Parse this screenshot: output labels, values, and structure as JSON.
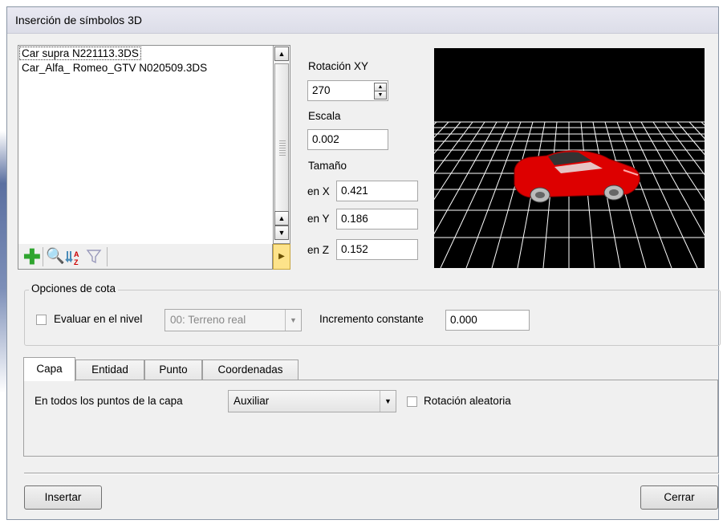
{
  "window": {
    "title": "Inserción de símbolos 3D"
  },
  "symbols": {
    "items": [
      "Car supra N221113.3DS",
      "Car_Alfa_ Romeo_GTV N020509.3DS"
    ],
    "selected_index": 0,
    "toolbar_icons": [
      "add-icon",
      "zoom-icon",
      "sort-az-icon",
      "filter-icon",
      "play-arrow-icon"
    ]
  },
  "rotation": {
    "label": "Rotación XY",
    "value": "270"
  },
  "scale": {
    "label": "Escala",
    "value": "0.002"
  },
  "size": {
    "label": "Tamaño",
    "x_label": "en X",
    "x_value": "0.421",
    "y_label": "en Y",
    "y_value": "0.186",
    "z_label": "en Z",
    "z_value": "0.152"
  },
  "preview": {
    "background": "#000000",
    "grid_color": "#ffffff",
    "model_color": "#dd0000"
  },
  "cota": {
    "legend": "Opciones de cota",
    "evaluate_label": "Evaluar en el nivel",
    "evaluate_checked": false,
    "level_value": "00: Terreno real",
    "increment_label": "Incremento constante",
    "increment_value": "0.000"
  },
  "tabs": [
    "Capa",
    "Entidad",
    "Punto",
    "Coordenadas"
  ],
  "active_tab": 0,
  "capa": {
    "points_label": "En todos los puntos de la capa",
    "layer_value": "Auxiliar",
    "random_rotation_label": "Rotación aleatoria",
    "random_rotation_checked": false
  },
  "buttons": {
    "insert": "Insertar",
    "close": "Cerrar"
  }
}
